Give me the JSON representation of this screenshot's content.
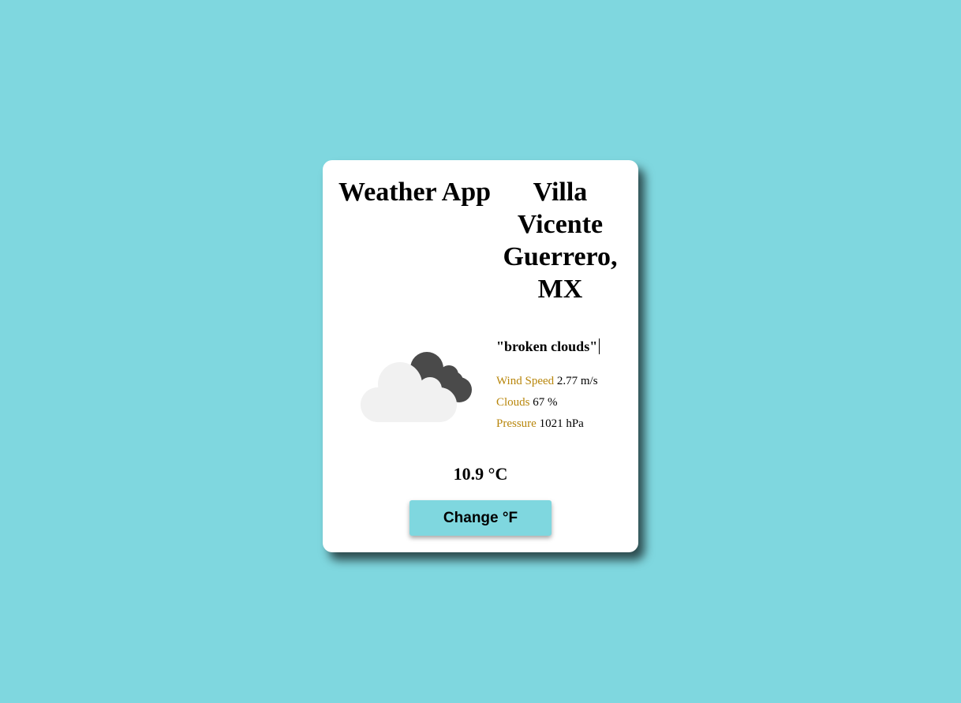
{
  "app": {
    "title": "Weather App"
  },
  "location": {
    "name": "Villa Vicente Guerrero, MX"
  },
  "weather": {
    "icon": "broken-clouds-icon",
    "description": "\"broken clouds\"",
    "details": [
      {
        "label": "Wind Speed",
        "value": "2.77 m/s"
      },
      {
        "label": "Clouds",
        "value": "67 %"
      },
      {
        "label": "Pressure",
        "value": "1021 hPa"
      }
    ],
    "temperature": "10.9 °C"
  },
  "controls": {
    "change_unit_label": "Change °F"
  },
  "colors": {
    "background": "#7fd7df",
    "card": "#ffffff",
    "detail_label": "#b8860b",
    "cloud_dark": "#4a4a4a",
    "cloud_light": "#f1f1f1"
  }
}
